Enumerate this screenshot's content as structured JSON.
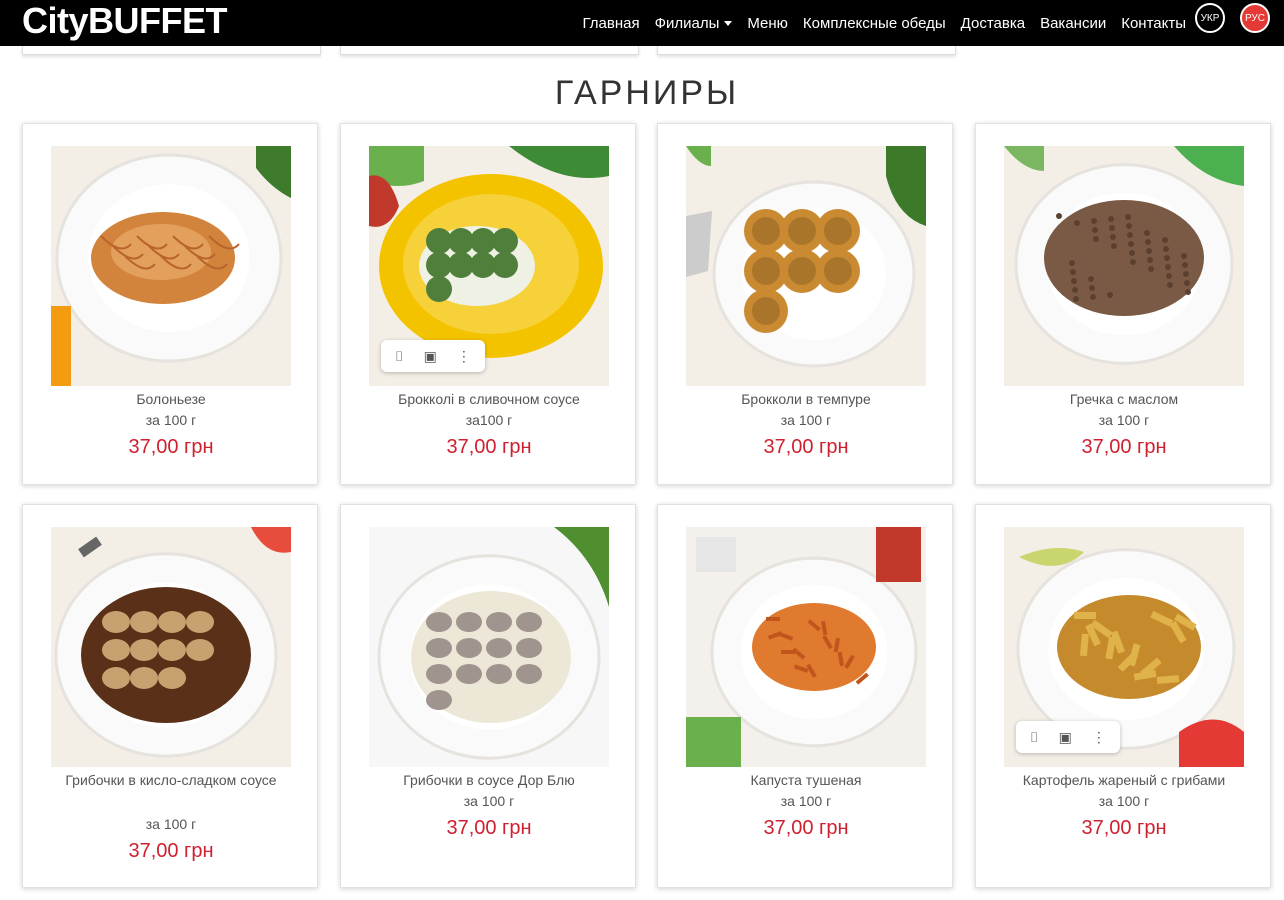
{
  "header": {
    "logo": "CityBUFFET",
    "nav": [
      {
        "label": "Главная",
        "name": "nav-home"
      },
      {
        "label": "Филиалы",
        "name": "nav-branches",
        "dropdown": true
      },
      {
        "label": "Меню",
        "name": "nav-menu"
      },
      {
        "label": "Комплексные обеды",
        "name": "nav-lunches"
      },
      {
        "label": "Доставка",
        "name": "nav-delivery"
      },
      {
        "label": "Вакансии",
        "name": "nav-vacancies"
      },
      {
        "label": "Контакты",
        "name": "nav-contacts"
      }
    ],
    "languages": [
      {
        "label": "УКР",
        "active": false
      },
      {
        "label": "РУС",
        "active": true
      }
    ]
  },
  "section": {
    "title": "ГАРНИРЫ"
  },
  "products": [
    {
      "name": "Болоньезе",
      "weight": "за 100 г",
      "price": "37,00 грн",
      "food": "pasta",
      "icons": [
        "carrot-icon",
        "greens-icon"
      ]
    },
    {
      "name": "Брокколі в сливочном соусе",
      "weight": "за100 г",
      "price": "37,00 грн",
      "food": "broccoli-cream",
      "overlay": true,
      "icons": [
        "pepper-icon",
        "greens-icon"
      ]
    },
    {
      "name": "Брокколи в темпуре",
      "weight": "за 100 г",
      "price": "37,00 грн",
      "food": "tempura",
      "icons": [
        "knife-icon",
        "broccoli-icon"
      ]
    },
    {
      "name": "Гречка с маслом",
      "weight": "за 100 г",
      "price": "37,00 грн",
      "food": "buckwheat",
      "icons": [
        "greens-icon"
      ]
    },
    {
      "name": "Грибочки в кисло-сладком соусе",
      "weight": "за 100 г",
      "price": "37,00 грн",
      "food": "mushrooms-sauce",
      "icons": [
        "tomato-icon"
      ]
    },
    {
      "name": "Грибочки в соусе Дор Блю",
      "weight": "за 100 г",
      "price": "37,00 грн",
      "food": "mushrooms-cream",
      "icons": [
        "dill-icon"
      ]
    },
    {
      "name": "Капуста тушеная",
      "weight": "за 100 г",
      "price": "37,00 грн",
      "food": "cabbage",
      "icons": [
        "glass-icon",
        "greens-icon"
      ]
    },
    {
      "name": "Картофель жареный с грибами",
      "weight": "за 100 г",
      "price": "37,00 грн",
      "food": "potatoes",
      "overlay": true,
      "icons": [
        "avocado-icon",
        "tomato-icon"
      ]
    }
  ],
  "overlay_icons": [
    "bookmark-icon",
    "camera-icon",
    "more-vertical-icon"
  ],
  "colors": {
    "price": "#cf2030",
    "navbar": "#000000",
    "active_lang": "#e53935"
  }
}
